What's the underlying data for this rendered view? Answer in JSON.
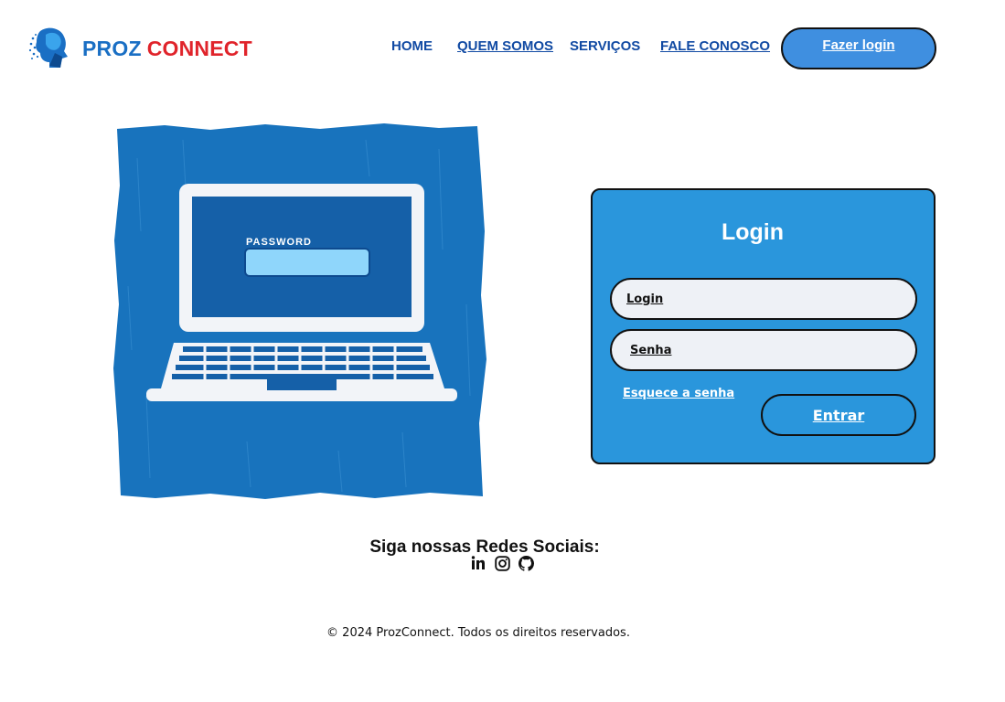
{
  "header": {
    "brand_part1": "PROZ",
    "brand_part2": "CONNECT",
    "nav": {
      "home": "HOME",
      "about": "QUEM SOMOS",
      "services": "SERVIÇOS",
      "contact": "FALE CONOSCO"
    },
    "login_button": "Fazer login"
  },
  "illustration": {
    "password_label": "PASSWORD",
    "icon": "laptop-password-icon"
  },
  "login_card": {
    "title": "Login",
    "login_placeholder": "Login",
    "password_placeholder": "Senha",
    "forgot_link": "Esquece a senha",
    "submit_button": "Entrar"
  },
  "social": {
    "title": "Siga nossas Redes Sociais:",
    "icons": [
      "linkedin-icon",
      "instagram-icon",
      "github-icon"
    ]
  },
  "footer": {
    "copyright": "© 2024 ProzConnect. Todos os direitos reservados."
  },
  "colors": {
    "brand_blue": "#1a6fc4",
    "brand_red": "#e0242b",
    "nav_blue": "#114aa3",
    "card_blue": "#2a96dc",
    "button_blue": "#3f8fe0",
    "illustration_blue": "#1873bd"
  }
}
